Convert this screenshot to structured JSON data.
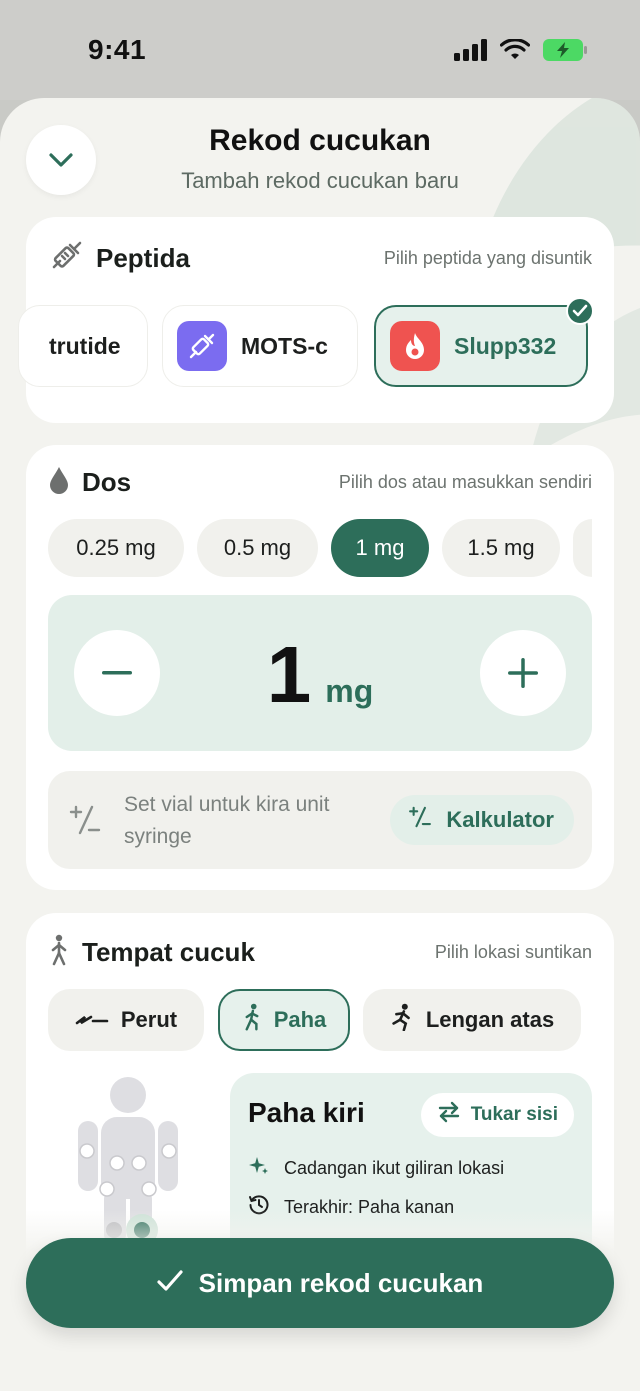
{
  "status": {
    "time": "9:41"
  },
  "header": {
    "title": "Rekod cucukan",
    "subtitle": "Tambah rekod cucukan baru"
  },
  "peptida": {
    "title": "Peptida",
    "hint": "Pilih peptida yang disuntik",
    "items": [
      {
        "label": "trutide",
        "icon": "none"
      },
      {
        "label": "MOTS-c",
        "icon": "syringe-icon",
        "color": "#7b6cf0"
      },
      {
        "label": "Slupp332",
        "icon": "flame-icon",
        "color": "#ef5350",
        "selected": true
      }
    ]
  },
  "dos": {
    "title": "Dos",
    "hint": "Pilih dos atau masukkan sendiri",
    "options": [
      "0.25 mg",
      "0.5 mg",
      "1 mg",
      "1.5 mg"
    ],
    "selected": "1 mg",
    "value": "1",
    "unit": "mg",
    "vial_text": "Set vial untuk kira unit syringe",
    "calc_label": "Kalkulator"
  },
  "tempat": {
    "title": "Tempat cucuk",
    "hint": "Pilih lokasi suntikan",
    "tabs": [
      "Perut",
      "Paha",
      "Lengan atas"
    ],
    "selected_tab": "Paha",
    "detail": {
      "title": "Paha kiri",
      "swap_label": "Tukar sisi",
      "suggestion": "Cadangan ikut giliran lokasi",
      "last": "Terakhir: Paha kanan"
    }
  },
  "save_label": "Simpan rekod cucukan",
  "colors": {
    "accent": "#2d6e5a",
    "accent_light": "#e6f1ec",
    "background": "#f3f3ef"
  }
}
